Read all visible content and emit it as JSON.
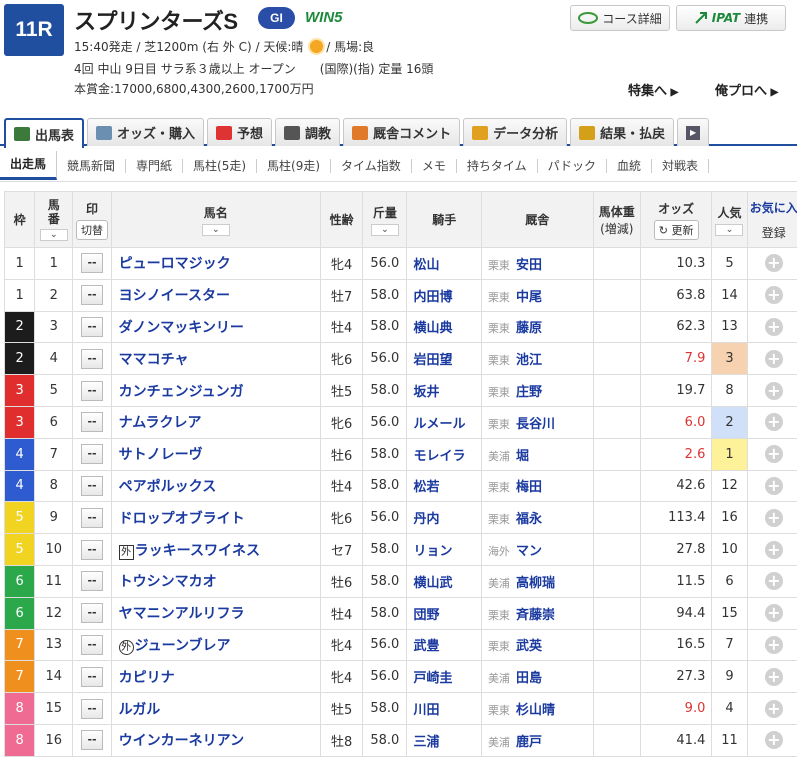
{
  "race": {
    "number": "11R",
    "name": "スプリンターズS",
    "grade": "GI",
    "win5": "WIN5",
    "info_line1a": "15:40発走 / 芝1200m (右 外 C) / 天候:晴",
    "info_line1b": "/ 馬場:良",
    "info_line2": "4回 中山 9日目 サラ系３歳以上 オープン　　(国際)(指) 定量 16頭",
    "info_line3": "本賞金:17000,6800,4300,2600,1700万円"
  },
  "buttons": {
    "course": "コース詳細",
    "ipat": "IPAT",
    "ipat_suffix": "連携"
  },
  "links": {
    "tokushu": "特集へ",
    "orepro": "俺プロへ"
  },
  "tabs": [
    {
      "label": "出馬表",
      "icon": "table-icon",
      "color": "#3c7a3c"
    },
    {
      "label": "オッズ・購入",
      "icon": "ticket-icon",
      "color": "#6a8fb0"
    },
    {
      "label": "予想",
      "icon": "target-icon",
      "color": "#d33"
    },
    {
      "label": "調教",
      "icon": "stopwatch-icon",
      "color": "#555"
    },
    {
      "label": "厩舎コメント",
      "icon": "stable-icon",
      "color": "#e07a2a"
    },
    {
      "label": "データ分析",
      "icon": "bar-chart-icon",
      "color": "#e0a020"
    },
    {
      "label": "結果・払戻",
      "icon": "coins-icon",
      "color": "#d4a017"
    }
  ],
  "subnav": [
    "出走馬",
    "競馬新聞",
    "専門紙",
    "馬柱(5走)",
    "馬柱(9走)",
    "タイム指数",
    "メモ",
    "持ちタイム",
    "パドック",
    "血統",
    "対戦表"
  ],
  "headers": {
    "waku": "枠",
    "umaban": "馬\n番",
    "mark": "印",
    "mark_btn": "切替",
    "name": "馬名",
    "sex_age": "性齢",
    "weight": "斤量",
    "jockey": "騎手",
    "trainer": "厩舎",
    "body": "馬体重",
    "body_sub": "(増減)",
    "odds": "オッズ",
    "odds_btn": "更新",
    "pop": "人気",
    "fav": "お気に入",
    "fav_btn": "登録"
  },
  "mark_default": "--",
  "rows": [
    {
      "waku": "1",
      "umaban": "1",
      "name": "ピューロマジック",
      "tag": "",
      "sex_age": "牝4",
      "weight": "56.0",
      "jockey": "松山",
      "region": "栗東",
      "trainer": "安田",
      "odds": "10.3",
      "odds_red": false,
      "pop": "5",
      "pop_rank": 0
    },
    {
      "waku": "1",
      "umaban": "2",
      "name": "ヨシノイースター",
      "tag": "",
      "sex_age": "牡7",
      "weight": "58.0",
      "jockey": "内田博",
      "region": "栗東",
      "trainer": "中尾",
      "odds": "63.8",
      "odds_red": false,
      "pop": "14",
      "pop_rank": 0
    },
    {
      "waku": "2",
      "umaban": "3",
      "name": "ダノンマッキンリー",
      "tag": "",
      "sex_age": "牡4",
      "weight": "58.0",
      "jockey": "横山典",
      "region": "栗東",
      "trainer": "藤原",
      "odds": "62.3",
      "odds_red": false,
      "pop": "13",
      "pop_rank": 0
    },
    {
      "waku": "2",
      "umaban": "4",
      "name": "ママコチャ",
      "tag": "",
      "sex_age": "牝6",
      "weight": "56.0",
      "jockey": "岩田望",
      "region": "栗東",
      "trainer": "池江",
      "odds": "7.9",
      "odds_red": true,
      "pop": "3",
      "pop_rank": 3
    },
    {
      "waku": "3",
      "umaban": "5",
      "name": "カンチェンジュンガ",
      "tag": "",
      "sex_age": "牡5",
      "weight": "58.0",
      "jockey": "坂井",
      "region": "栗東",
      "trainer": "庄野",
      "odds": "19.7",
      "odds_red": false,
      "pop": "8",
      "pop_rank": 0
    },
    {
      "waku": "3",
      "umaban": "6",
      "name": "ナムラクレア",
      "tag": "",
      "sex_age": "牝6",
      "weight": "56.0",
      "jockey": "ルメール",
      "region": "栗東",
      "trainer": "長谷川",
      "odds": "6.0",
      "odds_red": true,
      "pop": "2",
      "pop_rank": 2
    },
    {
      "waku": "4",
      "umaban": "7",
      "name": "サトノレーヴ",
      "tag": "",
      "sex_age": "牡6",
      "weight": "58.0",
      "jockey": "モレイラ",
      "region": "美浦",
      "trainer": "堀",
      "odds": "2.6",
      "odds_red": true,
      "pop": "1",
      "pop_rank": 1
    },
    {
      "waku": "4",
      "umaban": "8",
      "name": "ペアポルックス",
      "tag": "",
      "sex_age": "牡4",
      "weight": "58.0",
      "jockey": "松若",
      "region": "栗東",
      "trainer": "梅田",
      "odds": "42.6",
      "odds_red": false,
      "pop": "12",
      "pop_rank": 0
    },
    {
      "waku": "5",
      "umaban": "9",
      "name": "ドロップオブライト",
      "tag": "",
      "sex_age": "牝6",
      "weight": "56.0",
      "jockey": "丹内",
      "region": "栗東",
      "trainer": "福永",
      "odds": "113.4",
      "odds_red": false,
      "pop": "16",
      "pop_rank": 0
    },
    {
      "waku": "5",
      "umaban": "10",
      "name": "ラッキースワイネス",
      "tag": "外",
      "sex_age": "セ7",
      "weight": "58.0",
      "jockey": "リョン",
      "region": "海外",
      "trainer": "マン",
      "odds": "27.8",
      "odds_red": false,
      "pop": "10",
      "pop_rank": 0
    },
    {
      "waku": "6",
      "umaban": "11",
      "name": "トウシンマカオ",
      "tag": "",
      "sex_age": "牡6",
      "weight": "58.0",
      "jockey": "横山武",
      "region": "美浦",
      "trainer": "高柳瑞",
      "odds": "11.5",
      "odds_red": false,
      "pop": "6",
      "pop_rank": 0
    },
    {
      "waku": "6",
      "umaban": "12",
      "name": "ヤマニンアルリフラ",
      "tag": "",
      "sex_age": "牡4",
      "weight": "58.0",
      "jockey": "団野",
      "region": "栗東",
      "trainer": "斉藤崇",
      "odds": "94.4",
      "odds_red": false,
      "pop": "15",
      "pop_rank": 0
    },
    {
      "waku": "7",
      "umaban": "13",
      "name": "ジューンブレア",
      "tag": "外",
      "sex_age": "牝4",
      "weight": "56.0",
      "jockey": "武豊",
      "region": "栗東",
      "trainer": "武英",
      "odds": "16.5",
      "odds_red": false,
      "pop": "7",
      "pop_rank": 0
    },
    {
      "waku": "7",
      "umaban": "14",
      "name": "カピリナ",
      "tag": "",
      "sex_age": "牝4",
      "weight": "56.0",
      "jockey": "戸崎圭",
      "region": "美浦",
      "trainer": "田島",
      "odds": "27.3",
      "odds_red": false,
      "pop": "9",
      "pop_rank": 0
    },
    {
      "waku": "8",
      "umaban": "15",
      "name": "ルガル",
      "tag": "",
      "sex_age": "牡5",
      "weight": "58.0",
      "jockey": "川田",
      "region": "栗東",
      "trainer": "杉山晴",
      "odds": "9.0",
      "odds_red": true,
      "pop": "4",
      "pop_rank": 0
    },
    {
      "waku": "8",
      "umaban": "16",
      "name": "ウインカーネリアン",
      "tag": "",
      "sex_age": "牡8",
      "weight": "58.0",
      "jockey": "三浦",
      "region": "美浦",
      "trainer": "鹿戸",
      "odds": "41.4",
      "odds_red": false,
      "pop": "11",
      "pop_rank": 0
    }
  ]
}
